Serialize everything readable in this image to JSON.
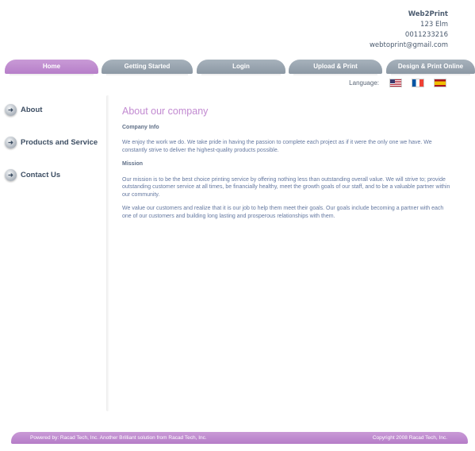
{
  "company": {
    "name": "Web2Print",
    "address": "123 Elm",
    "phone": "0011233216",
    "email": "webtoprint@gmail.com"
  },
  "nav": {
    "home": "Home",
    "getting_started": "Getting Started",
    "login": "Login",
    "upload_print": "Upload & Print",
    "design_print": "Design & Print Online"
  },
  "language": {
    "label": "Language:",
    "flags": [
      "us-flag-icon",
      "france-flag-icon",
      "spain-flag-icon"
    ]
  },
  "sidebar": {
    "items": [
      {
        "label": "About",
        "icon": "arrow-circle-icon"
      },
      {
        "label": "Products and Service",
        "icon": "arrow-circle-icon"
      },
      {
        "label": "Contact Us",
        "icon": "arrow-circle-icon"
      }
    ]
  },
  "main": {
    "title": "About our company",
    "company_info_heading": "Company Info",
    "company_info_text": "We enjoy the work we do. We take pride in having the passion to complete each project as if it were the only one we have. We constantly strive to deliver the highest-quality products possible.",
    "mission_heading": "Mission",
    "mission_text": "Our mission is to be the best choice printing service by offering nothing less than outstanding overall value. We will strive to; provide outstanding customer service at all times, be financially healthy, meet the growth goals of our staff, and to be a valuable partner within our community.",
    "values_text": "We value our customers and realize that it is our job to help them meet their goals. Our goals include becoming a partner with each one of our customers and building long lasting and prosperous relationships with them."
  },
  "footer": {
    "left": "Powered by: Racad Tech, Inc. Another Brilliant solution from Racad Tech, Inc.",
    "right": "Copyright 2008 Racad Tech, Inc."
  },
  "colors": {
    "accent_purple": "#c28ad1",
    "nav_grey": "#8c98a4",
    "text_blue": "#6478a0"
  }
}
